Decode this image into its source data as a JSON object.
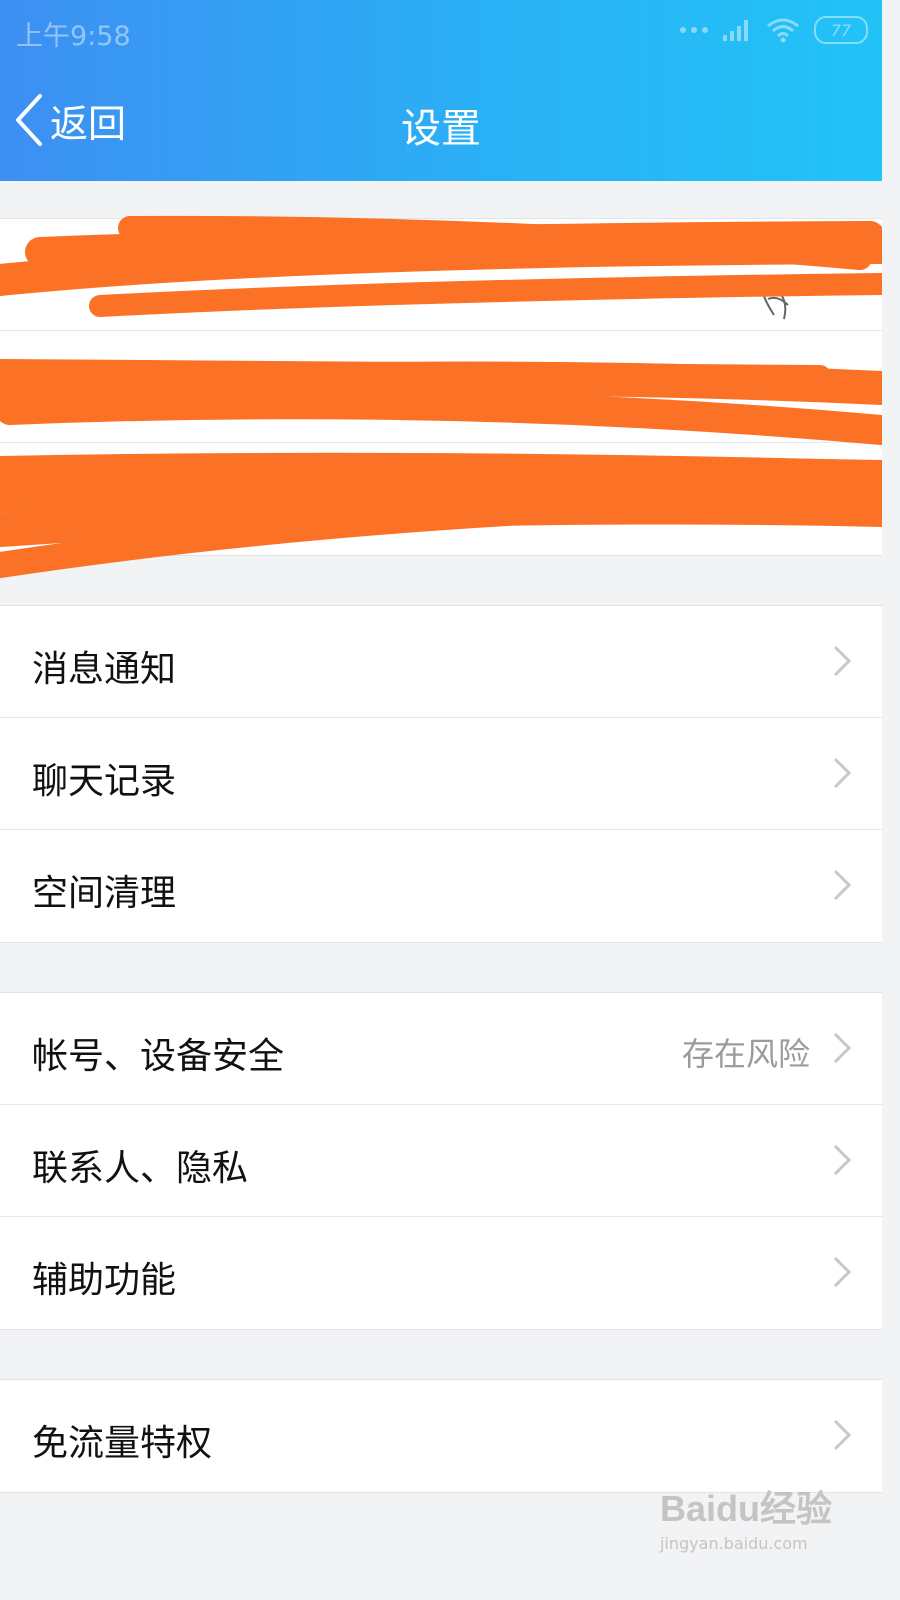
{
  "status_bar": {
    "time": "上午9:58",
    "battery": "77"
  },
  "nav": {
    "back_label": "返回",
    "title": "设置"
  },
  "groups": [
    {
      "items": [
        {
          "label": "",
          "redacted": true
        },
        {
          "label": "",
          "redacted": true
        },
        {
          "label": "",
          "redacted": true
        }
      ]
    },
    {
      "items": [
        {
          "label": "消息通知"
        },
        {
          "label": "聊天记录"
        },
        {
          "label": "空间清理"
        }
      ]
    },
    {
      "items": [
        {
          "label": "帐号、设备安全",
          "value": "存在风险"
        },
        {
          "label": "联系人、隐私"
        },
        {
          "label": "辅助功能"
        }
      ]
    },
    {
      "items": [
        {
          "label": "免流量特权"
        }
      ]
    }
  ],
  "watermark": {
    "logo": "Baidu经验",
    "url": "jingyan.baidu.com"
  },
  "colors": {
    "header_start": "#3d8ff2",
    "header_end": "#22c3f7",
    "redaction": "#fb7226",
    "chevron": "#c7c7cc"
  }
}
